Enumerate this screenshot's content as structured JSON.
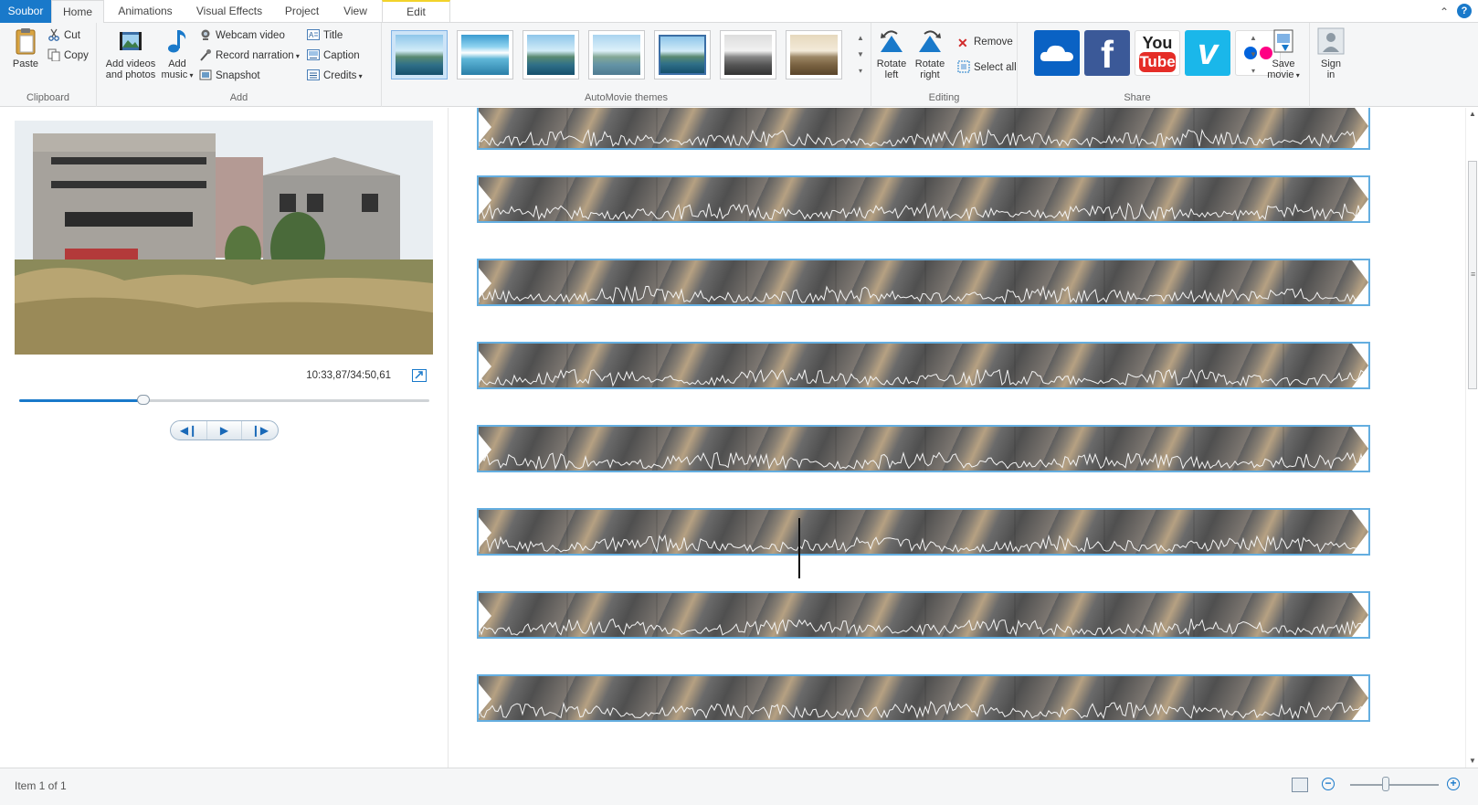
{
  "tabs": {
    "file": "Soubor",
    "home": "Home",
    "animations": "Animations",
    "visual_effects": "Visual Effects",
    "project": "Project",
    "view": "View",
    "edit": "Edit"
  },
  "ribbon": {
    "clipboard": {
      "label": "Clipboard",
      "paste": "Paste",
      "cut": "Cut",
      "copy": "Copy"
    },
    "add": {
      "label": "Add",
      "add_videos_line1": "Add videos",
      "add_videos_line2": "and photos",
      "add_music_line1": "Add",
      "add_music_line2": "music",
      "webcam": "Webcam video",
      "narration": "Record narration",
      "snapshot": "Snapshot",
      "title": "Title",
      "caption": "Caption",
      "credits": "Credits"
    },
    "themes": {
      "label": "AutoMovie themes",
      "count": 7
    },
    "editing": {
      "label": "Editing",
      "rotate_left_1": "Rotate",
      "rotate_left_2": "left",
      "rotate_right_1": "Rotate",
      "rotate_right_2": "right",
      "remove": "Remove",
      "select_all": "Select all"
    },
    "share": {
      "label": "Share",
      "services": [
        "onedrive-icon",
        "facebook-icon",
        "youtube-icon",
        "vimeo-icon",
        "flickr-icon"
      ],
      "youtube_1": "You",
      "youtube_2": "Tube",
      "facebook": "f",
      "vimeo": "v",
      "save_movie_1": "Save",
      "save_movie_2": "movie",
      "sign_in_1": "Sign",
      "sign_in_2": "in"
    }
  },
  "preview": {
    "timecode": "10:33,87/34:50,61",
    "progress_fraction": 0.303
  },
  "storyboard": {
    "rows": 8
  },
  "status": {
    "text": "Item 1 of 1",
    "zoom_fraction": 0.4
  },
  "colors": {
    "accent": "#1979ca",
    "clip_border": "#64aee0",
    "edit_tab_highlight": "#f2d32b"
  }
}
